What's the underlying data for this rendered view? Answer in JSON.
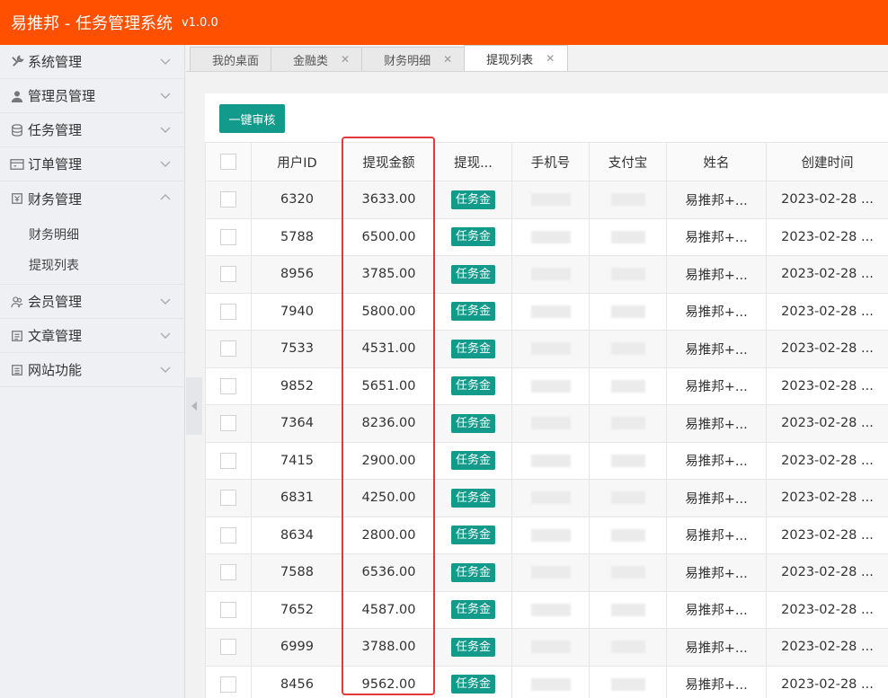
{
  "app": {
    "title": "易推邦 - 任务管理系统",
    "version": "v1.0.0"
  },
  "sidebar": {
    "items": [
      {
        "label": "系统管理",
        "icon": "wrench-icon",
        "expanded": false
      },
      {
        "label": "管理员管理",
        "icon": "user-icon",
        "expanded": false
      },
      {
        "label": "任务管理",
        "icon": "database-icon",
        "expanded": false
      },
      {
        "label": "订单管理",
        "icon": "order-icon",
        "expanded": false
      },
      {
        "label": "财务管理",
        "icon": "finance-icon",
        "expanded": true,
        "children": [
          "财务明细",
          "提现列表"
        ]
      },
      {
        "label": "会员管理",
        "icon": "members-icon",
        "expanded": false
      },
      {
        "label": "文章管理",
        "icon": "article-icon",
        "expanded": false
      },
      {
        "label": "网站功能",
        "icon": "site-icon",
        "expanded": false
      }
    ]
  },
  "tabs": [
    {
      "label": "我的桌面",
      "closable": false,
      "active": false
    },
    {
      "label": "金融类",
      "closable": true,
      "active": false
    },
    {
      "label": "财务明细",
      "closable": true,
      "active": false
    },
    {
      "label": "提现列表",
      "closable": true,
      "active": true
    }
  ],
  "toolbar": {
    "batch_review_label": "一键审核"
  },
  "table": {
    "headers": [
      "",
      "用户ID",
      "提现金额",
      "提现...",
      "手机号",
      "支付宝",
      "姓名",
      "创建时间"
    ],
    "rows": [
      {
        "user_id": "6320",
        "amount": "3633.00",
        "type": "任务金",
        "name": "易推邦+...",
        "created": "2023-02-28 ..."
      },
      {
        "user_id": "5788",
        "amount": "6500.00",
        "type": "任务金",
        "name": "易推邦+...",
        "created": "2023-02-28 ..."
      },
      {
        "user_id": "8956",
        "amount": "3785.00",
        "type": "任务金",
        "name": "易推邦+...",
        "created": "2023-02-28 ..."
      },
      {
        "user_id": "7940",
        "amount": "5800.00",
        "type": "任务金",
        "name": "易推邦+...",
        "created": "2023-02-28 ..."
      },
      {
        "user_id": "7533",
        "amount": "4531.00",
        "type": "任务金",
        "name": "易推邦+...",
        "created": "2023-02-28 ..."
      },
      {
        "user_id": "9852",
        "amount": "5651.00",
        "type": "任务金",
        "name": "易推邦+...",
        "created": "2023-02-28 ..."
      },
      {
        "user_id": "7364",
        "amount": "8236.00",
        "type": "任务金",
        "name": "易推邦+...",
        "created": "2023-02-28 ..."
      },
      {
        "user_id": "7415",
        "amount": "2900.00",
        "type": "任务金",
        "name": "易推邦+...",
        "created": "2023-02-28 ..."
      },
      {
        "user_id": "6831",
        "amount": "4250.00",
        "type": "任务金",
        "name": "易推邦+...",
        "created": "2023-02-28 ..."
      },
      {
        "user_id": "8634",
        "amount": "2800.00",
        "type": "任务金",
        "name": "易推邦+...",
        "created": "2023-02-28 ..."
      },
      {
        "user_id": "7588",
        "amount": "6536.00",
        "type": "任务金",
        "name": "易推邦+...",
        "created": "2023-02-28 ..."
      },
      {
        "user_id": "7652",
        "amount": "4587.00",
        "type": "任务金",
        "name": "易推邦+...",
        "created": "2023-02-28 ..."
      },
      {
        "user_id": "6999",
        "amount": "3788.00",
        "type": "任务金",
        "name": "易推邦+...",
        "created": "2023-02-28 ..."
      },
      {
        "user_id": "8456",
        "amount": "9562.00",
        "type": "任务金",
        "name": "易推邦+...",
        "created": "2023-02-28 ..."
      }
    ]
  },
  "colors": {
    "topbar": "#ff5000",
    "accent": "#129a8a",
    "highlight_box": "#e23a3a"
  }
}
